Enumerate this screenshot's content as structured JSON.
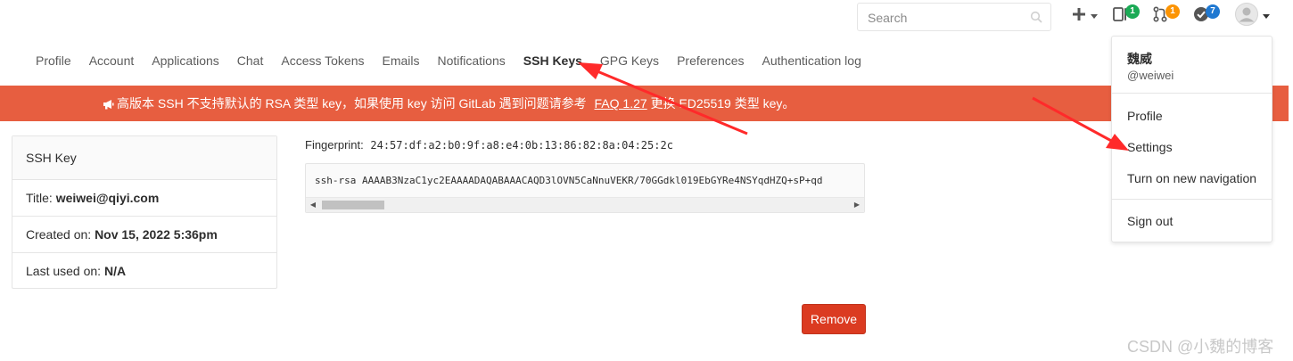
{
  "header": {
    "search_placeholder": "Search",
    "merge_requests_count": "1",
    "issues_count": "1",
    "todos_count": "7"
  },
  "tabs": [
    {
      "label": "Profile"
    },
    {
      "label": "Account"
    },
    {
      "label": "Applications"
    },
    {
      "label": "Chat"
    },
    {
      "label": "Access Tokens"
    },
    {
      "label": "Emails"
    },
    {
      "label": "Notifications"
    },
    {
      "label": "SSH Keys",
      "active": true
    },
    {
      "label": "GPG Keys"
    },
    {
      "label": "Preferences"
    },
    {
      "label": "Authentication log"
    }
  ],
  "broadcast": {
    "prefix": "高版本 SSH 不支持默认的 RSA 类型 key，如果使用 key 访问 GitLab 遇到问题请参考",
    "link": "FAQ 1.27",
    "suffix": "更换 ED25519 类型 key。"
  },
  "key_card": {
    "header": "SSH Key",
    "title_label": "Title:",
    "title_value": "weiwei@qiyi.com",
    "created_label": "Created on:",
    "created_value": "Nov 15, 2022 5:36pm",
    "last_used_label": "Last used on:",
    "last_used_value": "N/A"
  },
  "fingerprint": {
    "label": "Fingerprint:",
    "value": "24:57:df:a2:b0:9f:a8:e4:0b:13:86:82:8a:04:25:2c"
  },
  "public_key": "ssh-rsa AAAAB3NzaC1yc2EAAAADAQABAAACAQD3lOVN5CaNnuVEKR/70GGdkl019EbGYRe4NSYqdHZQ+sP+qd",
  "remove_button": "Remove",
  "user_menu": {
    "name": "魏威",
    "username": "@weiwei",
    "items": [
      "Profile",
      "Settings",
      "Turn on new navigation",
      "Sign out"
    ]
  },
  "colors": {
    "broadcast_bg": "#e75e40",
    "danger": "#db3b21",
    "badge_green": "#1aaa55",
    "badge_orange": "#fc9403",
    "badge_blue": "#1f78d1",
    "annotation_arrow": "#ff2a2a"
  },
  "watermark": "CSDN @小魏的博客"
}
